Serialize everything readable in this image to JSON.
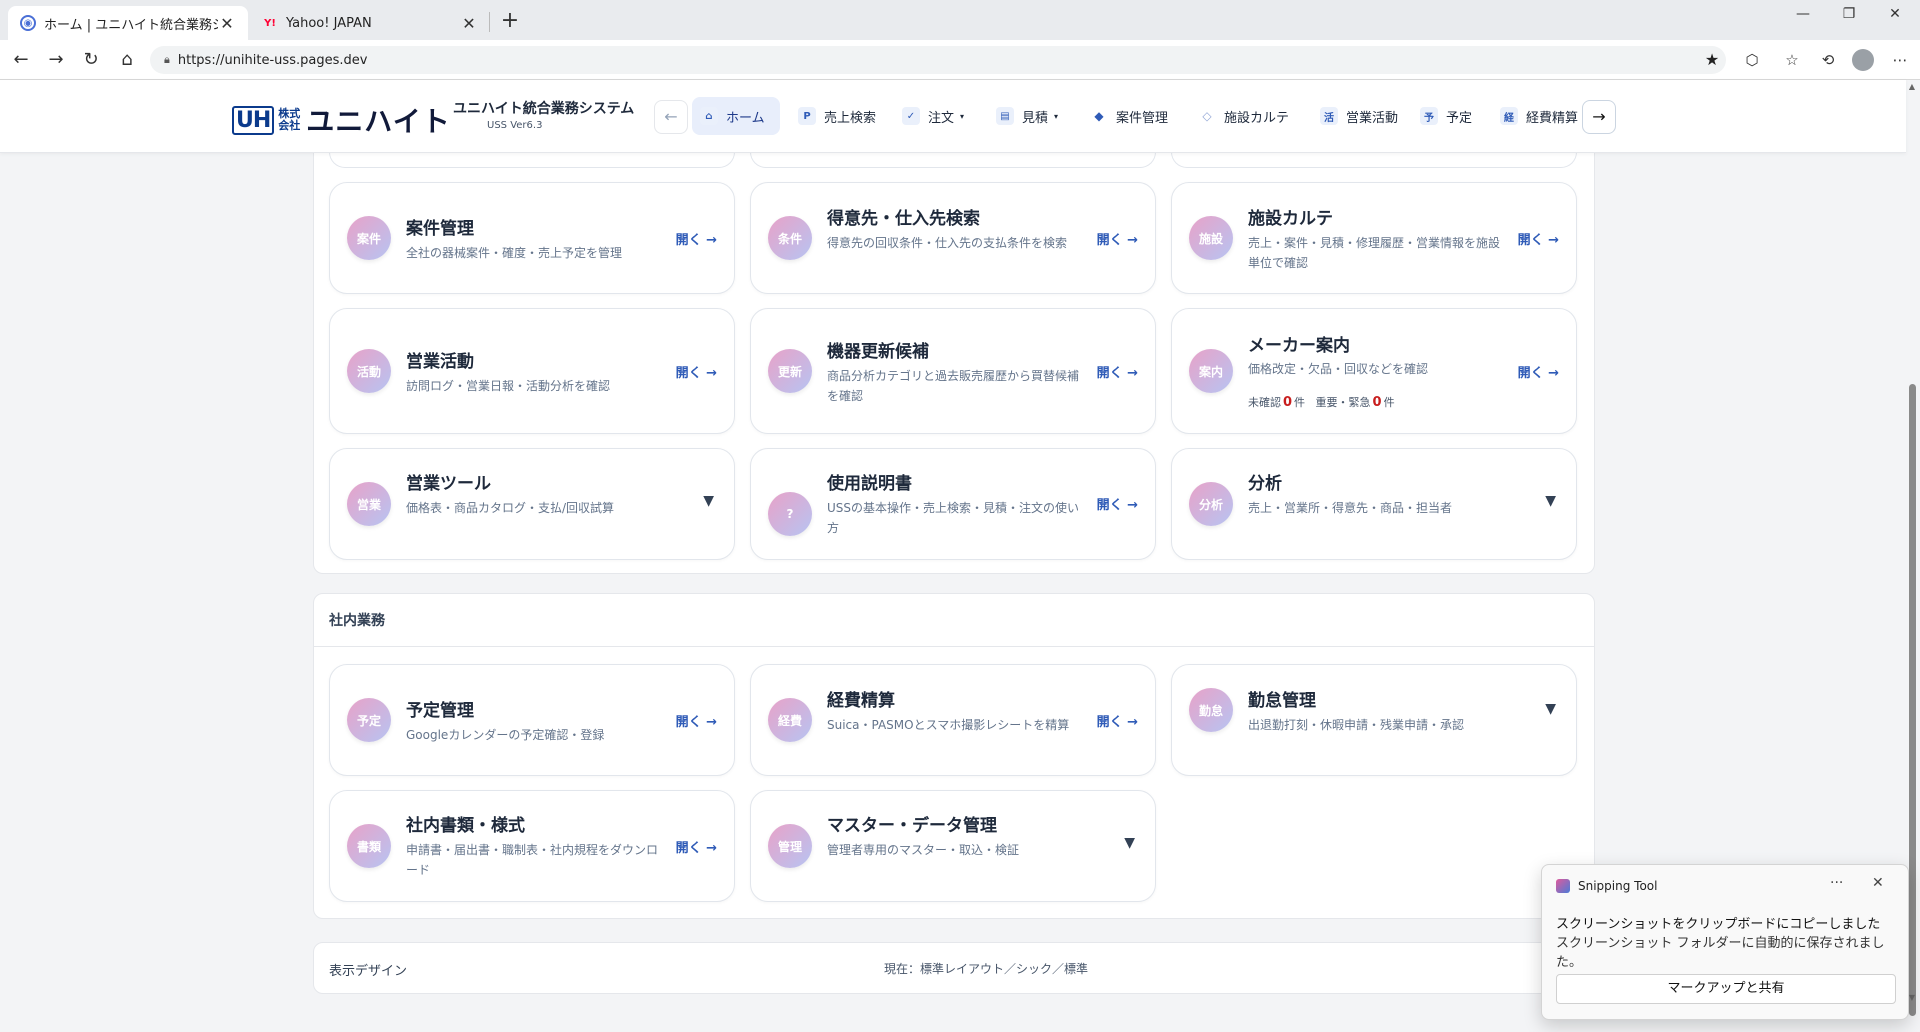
{
  "browser": {
    "tabs": [
      {
        "title": "ホーム | ユニハイト統合業務システム",
        "favicon": "app-icon"
      },
      {
        "title": "Yahoo! JAPAN",
        "favicon": "yahoo-icon"
      }
    ],
    "url": "https://unihite-uss.pages.dev"
  },
  "header": {
    "logo_mark": "UH",
    "logo_kabu": "株式会社",
    "logo_name": "ユニハイト",
    "system_name": "ユニハイト統合業務システム",
    "version": "USS Ver6.3",
    "back_arrow": "←",
    "forward_arrow": "→",
    "nav": [
      {
        "label": "ホーム",
        "icon": "⌂"
      },
      {
        "label": "売上検索",
        "icon": "P"
      },
      {
        "label": "注文",
        "icon": "✓",
        "caret": "▾"
      },
      {
        "label": "見積",
        "icon": "▤",
        "caret": "▾"
      },
      {
        "label": "案件管理",
        "icon": "◆"
      },
      {
        "label": "施設カルテ",
        "icon": "◇"
      },
      {
        "label": "営業活動",
        "icon": "活"
      },
      {
        "label": "予定",
        "icon": "予"
      },
      {
        "label": "経費精算",
        "icon": "経"
      }
    ]
  },
  "section1": {
    "cards": [
      {
        "badge": "案件",
        "title": "案件管理",
        "desc": "全社の器械案件・確度・売上予定を管理",
        "action": "開く →"
      },
      {
        "badge": "条件",
        "title": "得意先・仕入先検索",
        "desc": "得意先の回収条件・仕入先の支払条件を検索",
        "action": "開く →"
      },
      {
        "badge": "施設",
        "title": "施設カルテ",
        "desc": "売上・案件・見積・修理履歴・営業情報を施設単位で確認",
        "action": "開く →"
      },
      {
        "badge": "活動",
        "title": "営業活動",
        "desc": "訪問ログ・営業日報・活動分析を確認",
        "action": "開く →"
      },
      {
        "badge": "更新",
        "title": "機器更新候補",
        "desc": "商品分析カテゴリと過去販売履歴から買替候補を確認",
        "action": "開く →"
      },
      {
        "badge": "案内",
        "title": "メーカー案内",
        "desc": "価格改定・欠品・回収などを確認",
        "action": "開く →",
        "counts": {
          "unconfirmed_label": "未確認",
          "unconfirmed": "0",
          "unit1": "件",
          "urgent_label": "重要・緊急",
          "urgent": "0",
          "unit2": "件"
        }
      },
      {
        "badge": "営業",
        "title": "営業ツール",
        "desc": "価格表・商品カタログ・支払/回収試算",
        "action": "▼"
      },
      {
        "badge": "?",
        "title": "使用説明書",
        "desc": "USSの基本操作・売上検索・見積・注文の使い方",
        "action": "開く →"
      },
      {
        "badge": "分析",
        "title": "分析",
        "desc": "売上・営業所・得意先・商品・担当者",
        "action": "▼"
      }
    ]
  },
  "section2": {
    "title": "社内業務",
    "cards": [
      {
        "badge": "予定",
        "title": "予定管理",
        "desc": "Googleカレンダーの予定確認・登録",
        "action": "開く →"
      },
      {
        "badge": "経費",
        "title": "経費精算",
        "desc": "Suica・PASMOとスマホ撮影レシートを精算",
        "action": "開く →"
      },
      {
        "badge": "勤怠",
        "title": "勤怠管理",
        "desc": "出退勤打刻・休暇申請・残業申請・承認",
        "action": "▼"
      },
      {
        "badge": "書類",
        "title": "社内書類・様式",
        "desc": "申請書・届出書・職制表・社内規程をダウンロード",
        "action": "開く →"
      },
      {
        "badge": "管理",
        "title": "マスター・データ管理",
        "desc": "管理者専用のマスター・取込・検証",
        "action": "▼"
      }
    ]
  },
  "footer": {
    "label": "表示デザイン",
    "current": "現在：標準レイアウト／シック／標準"
  },
  "toast": {
    "app": "Snipping Tool",
    "more": "···",
    "close": "✕",
    "message1": "スクリーンショットをクリップボードにコピーしました",
    "message2": "スクリーンショット フォルダーに自動的に保存されました。",
    "button": "マークアップと共有"
  }
}
